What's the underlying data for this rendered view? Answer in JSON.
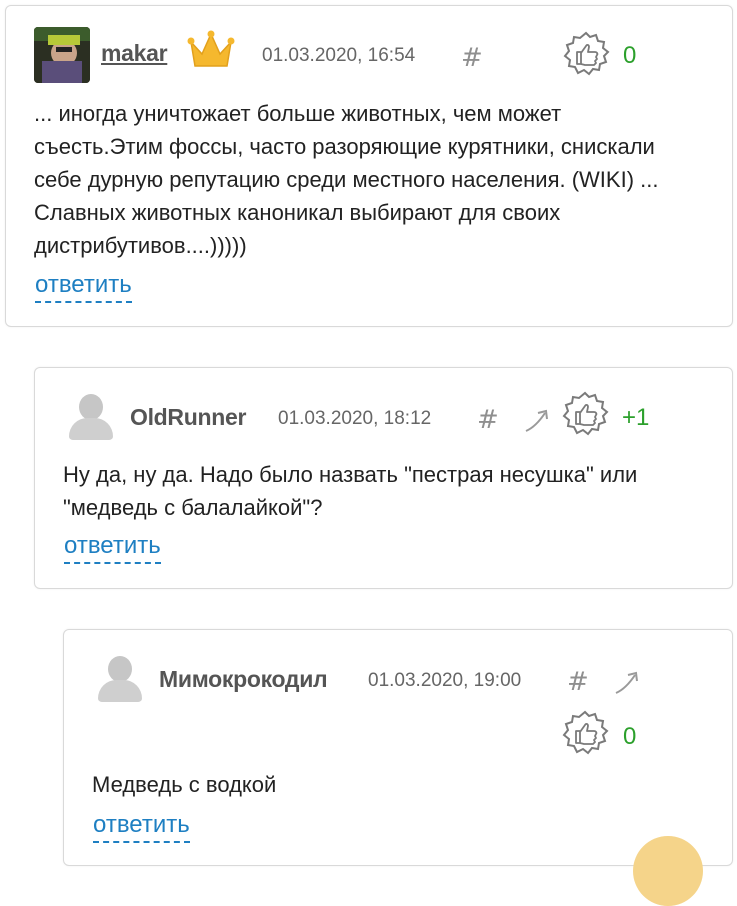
{
  "comments": [
    {
      "username": "makar",
      "timestamp": "01.03.2020, 16:54",
      "hash": "#",
      "score": "0",
      "text": "... иногда уничтожает больше животных, чем может съесть.Этим фоссы, часто разоряющие курятники, снискали себе дурную репутацию среди местного населения. (WIKI) ... Славных животных каноникал выбирают для своих дистрибутивов....)))))",
      "reply": "ответить"
    },
    {
      "username": "OldRunner",
      "timestamp": "01.03.2020, 18:12",
      "hash": "#",
      "score": "+1",
      "text": "Ну да, ну да. Надо было назвать \"пестрая несушка\" или \"медведь с балалайкой\"?",
      "reply": "ответить"
    },
    {
      "username": "Мимокрокодил",
      "timestamp": "01.03.2020, 19:00",
      "hash": "#",
      "score": "0",
      "text": "Медведь с водкой",
      "reply": "ответить"
    }
  ],
  "colors": {
    "score_green": "#2ca02c",
    "link_blue": "#1e7fc2",
    "crown_gold": "#f5b82e"
  },
  "icons": [
    "crown-icon",
    "hash-icon",
    "parent-arrow-icon",
    "thumbs-up-icon",
    "default-avatar-icon"
  ]
}
